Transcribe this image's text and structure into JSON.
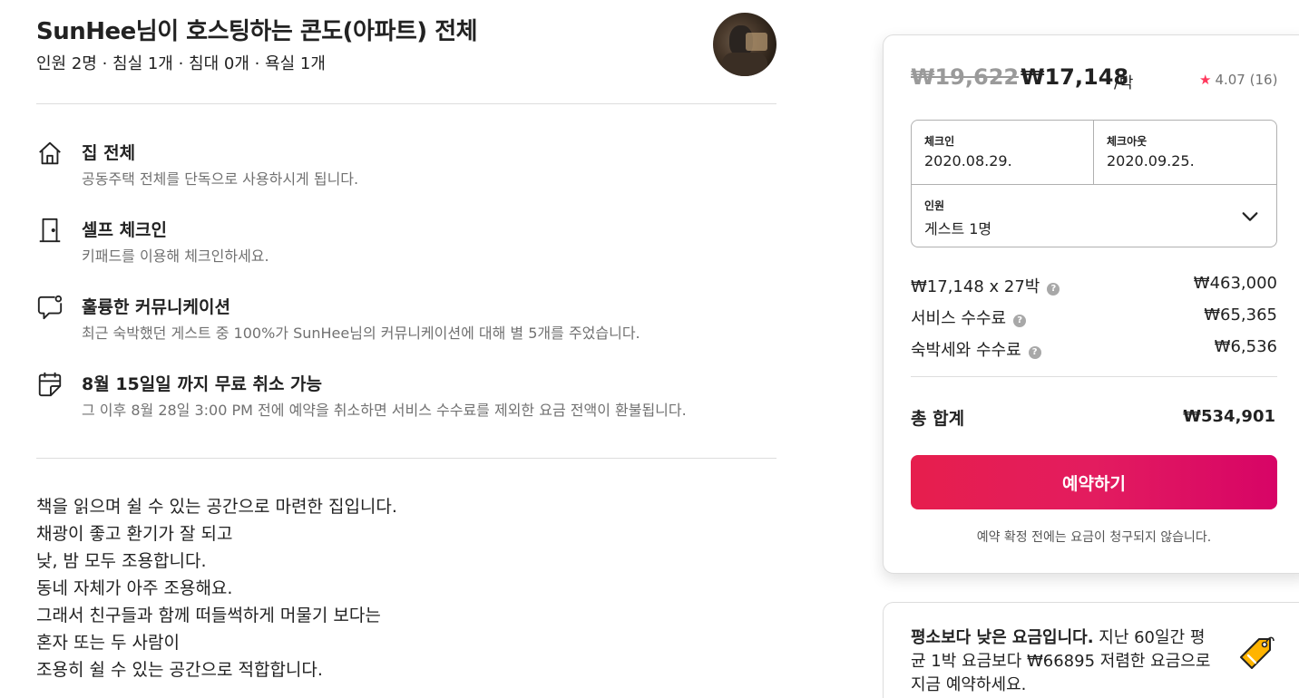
{
  "listing": {
    "title": "SunHee님이 호스팅하는 콘도(아파트) 전체",
    "subtitle": "인원 2명 · 침실 1개 · 침대 0개 · 욕실 1개",
    "host_avatar_icon": "host-avatar-photo"
  },
  "features": [
    {
      "icon": "home-icon",
      "title": "집 전체",
      "description": "공동주택 전체를 단독으로 사용하시게 됩니다."
    },
    {
      "icon": "door-icon",
      "title": "셀프 체크인",
      "description": "키패드를 이용해 체크인하세요."
    },
    {
      "icon": "chat-bubble-icon",
      "title": "훌륭한 커뮤니케이션",
      "description": "최근 숙박했던 게스트 중 100%가 SunHee님의 커뮤니케이션에 대해 별 5개를 주었습니다."
    },
    {
      "icon": "calendar-icon",
      "title": "8월 15일일 까지 무료 취소 가능",
      "description": "그 이후 8월 28일 3:00 PM 전에 예약을 취소하면 서비스 수수료를 제외한 요금 전액이 환불됩니다."
    }
  ],
  "description_lines": [
    "책을 읽으며 쉴 수 있는 공간으로 마련한 집입니다.",
    "채광이 좋고 환기가 잘 되고",
    "낮, 밤 모두 조용합니다.",
    "동네 자체가 아주 조용해요.",
    "그래서 친구들과 함께 떠들썩하게 머물기 보다는",
    "혼자 또는 두 사람이",
    "조용히 쉴 수 있는 공간으로 적합합니다."
  ],
  "booking": {
    "price_original": "₩19,622",
    "price_current": "₩17,148",
    "price_unit": "/박",
    "rating": "4.07",
    "review_count": "(16)",
    "checkin_label": "체크인",
    "checkin_value": "2020.08.29.",
    "checkout_label": "체크아웃",
    "checkout_value": "2020.09.25.",
    "guests_label": "인원",
    "guests_value": "게스트 1명",
    "line_items": [
      {
        "label": "₩17,148 x 27박",
        "value": "₩463,000"
      },
      {
        "label": "서비스 수수료",
        "value": "₩65,365"
      },
      {
        "label": "숙박세와 수수료",
        "value": "₩6,536"
      }
    ],
    "total_label": "총 합계",
    "total_value": "₩534,901",
    "reserve_label": "예약하기",
    "notice": "예약 확정 전에는 요금이 청구되지 않습니다.",
    "accent_color": "#e31c5f"
  },
  "low_price": {
    "headline": "평소보다 낮은 요금입니다.",
    "body": "지난 60일간 평균 1박 요금보다 ₩66895 저렴한 요금으로 지금 예약하세요.",
    "icon": "price-tag-icon"
  }
}
